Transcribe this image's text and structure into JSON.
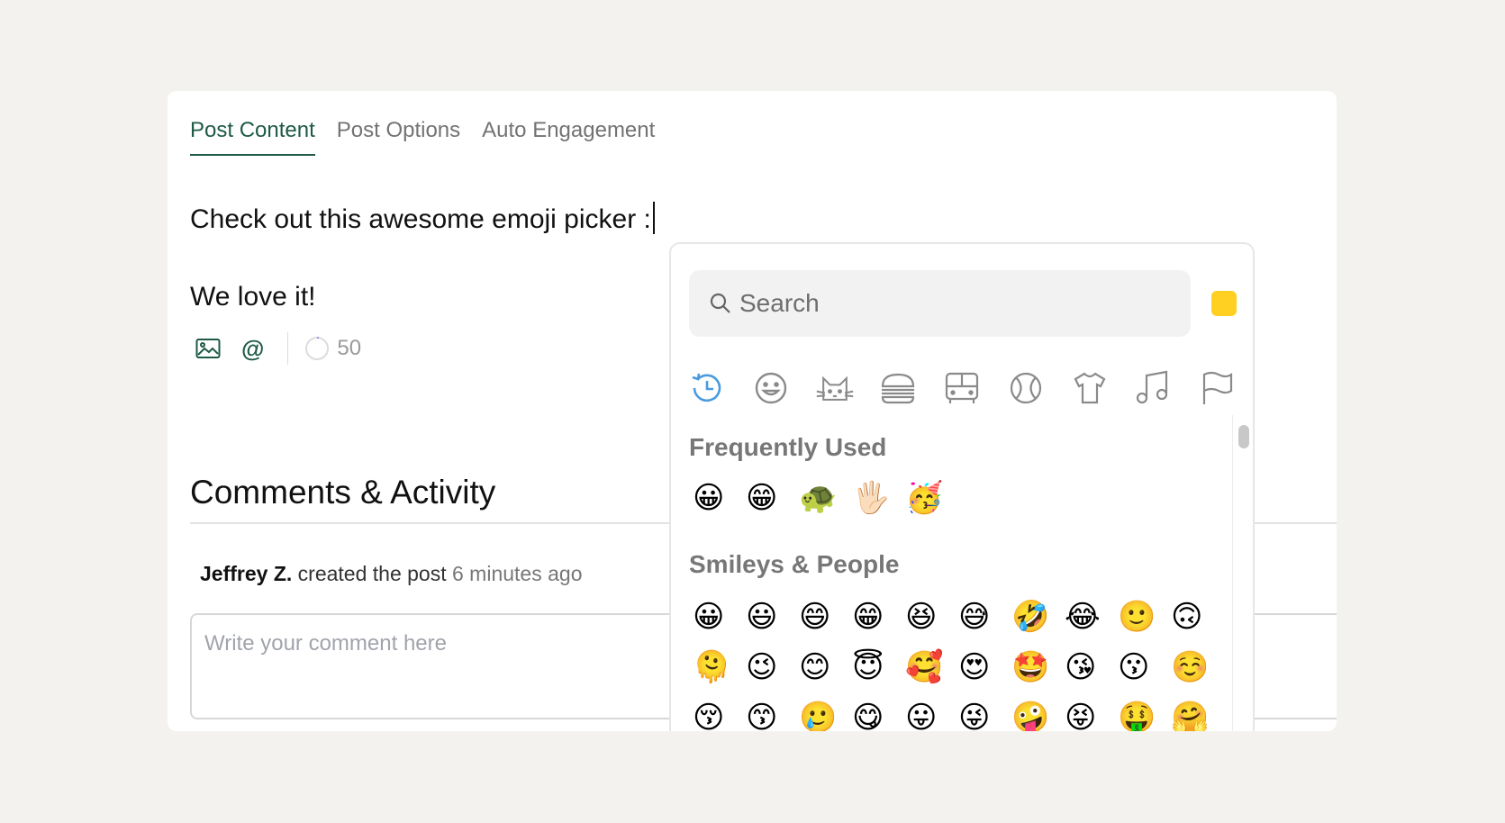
{
  "tabs": [
    {
      "label": "Post Content",
      "active": true
    },
    {
      "label": "Post Options",
      "active": false
    },
    {
      "label": "Auto Engagement",
      "active": false
    }
  ],
  "editor": {
    "line1": "Check out this awesome emoji picker :",
    "line2": "We love it!",
    "char_count": "50"
  },
  "comments": {
    "title": "Comments & Activity",
    "activity_actor": "Jeffrey Z.",
    "activity_action": "created the post",
    "activity_time": "6 minutes ago",
    "comment_placeholder": "Write your comment here"
  },
  "picker": {
    "search_placeholder": "Search",
    "skin_tone_color": "#ffd021",
    "active_category_color": "#4a9be0",
    "categories": [
      "clock-icon",
      "smiley-icon",
      "cat-icon",
      "burger-icon",
      "bus-icon",
      "ball-icon",
      "shirt-icon",
      "music-icon",
      "flag-icon"
    ],
    "frequently_used_title": "Frequently Used",
    "frequently_used": [
      "😀",
      "😁",
      "🐢",
      "🖐🏻",
      "🥳"
    ],
    "smileys_title": "Smileys & People",
    "smileys_rows": [
      [
        "😀",
        "😃",
        "😄",
        "😁",
        "😆",
        "😅",
        "🤣",
        "😂",
        "🙂",
        "🙃"
      ],
      [
        "🫠",
        "😉",
        "😊",
        "😇",
        "🥰",
        "😍",
        "🤩",
        "😘",
        "😗",
        "☺️"
      ],
      [
        "😚",
        "😙",
        "🥲",
        "😋",
        "😛",
        "😜",
        "🤪",
        "😝",
        "🤑",
        "🤗"
      ]
    ]
  },
  "theme": {
    "accent_green": "#1e5a46"
  }
}
